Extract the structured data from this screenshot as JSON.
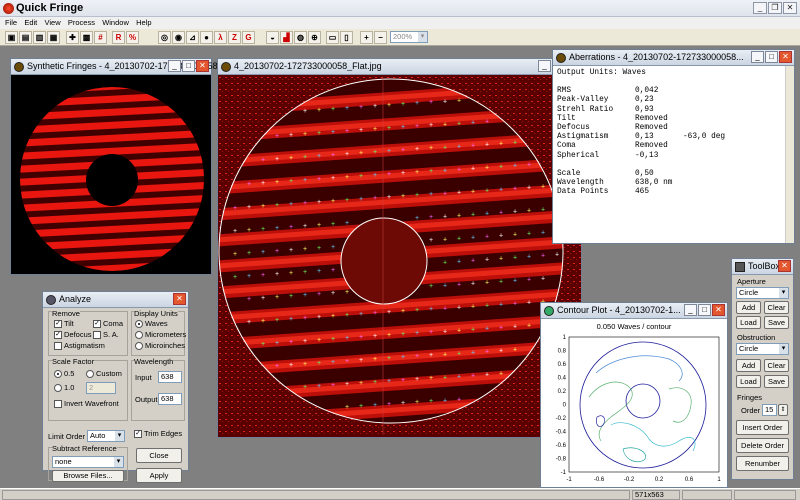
{
  "app": {
    "title": "Quick Fringe"
  },
  "menu": [
    "File",
    "Edit",
    "View",
    "Process",
    "Window",
    "Help"
  ],
  "toolbar": {
    "zoom": "200%",
    "icons": [
      "open-icon",
      "save-icon",
      "print-icon",
      "preview-icon",
      "tools-icon",
      "grid-icon",
      "table-icon",
      "r-icon",
      "percent-icon",
      "circle-icon",
      "fringe-icon",
      "plot-icon",
      "sphere-icon",
      "lambda-icon",
      "z-icon",
      "g-icon",
      "shell-icon",
      "chart-icon",
      "globe-icon",
      "export-icon",
      "zoom-in-icon",
      "zoom-out-icon"
    ]
  },
  "synthetic": {
    "title": "Synthetic Fringes - 4_20130702-172733000058..."
  },
  "flat": {
    "title": "4_20130702-172733000058_Flat.jpg"
  },
  "aberrations": {
    "title": "Aberrations - 4_20130702-172733000058...",
    "header": "Output Units: Waves",
    "rows": [
      {
        "k": "RMS",
        "v": "0,042",
        "x": ""
      },
      {
        "k": "Peak-Valley",
        "v": "0,23",
        "x": ""
      },
      {
        "k": "Strehl Ratio",
        "v": "0,93",
        "x": ""
      },
      {
        "k": "Tilt",
        "v": "Removed",
        "x": ""
      },
      {
        "k": "Defocus",
        "v": "Removed",
        "x": ""
      },
      {
        "k": "Astigmatism",
        "v": "0,13",
        "x": "-63,0 deg"
      },
      {
        "k": "Coma",
        "v": "Removed",
        "x": ""
      },
      {
        "k": "Spherical",
        "v": "-0,13",
        "x": ""
      }
    ],
    "rows2": [
      {
        "k": "Scale",
        "v": "0,50"
      },
      {
        "k": "Wavelength",
        "v": "638,0 nm"
      },
      {
        "k": "Data Points",
        "v": "465"
      }
    ]
  },
  "analyze": {
    "title": "Analyze",
    "remove": {
      "legend": "Remove",
      "tilt": "Tilt",
      "coma": "Coma",
      "defocus": "Defocus",
      "sa": "S. A.",
      "astig": "Astigmatism"
    },
    "display": {
      "legend": "Display Units",
      "waves": "Waves",
      "micrometers": "Micrometers",
      "microinches": "Microinches"
    },
    "scale": {
      "legend": "Scale Factor",
      "half": "0.5",
      "custom": "Custom",
      "one": "1.0",
      "custom_value": "2",
      "invert": "Invert Wavefront"
    },
    "wavelength": {
      "legend": "Wavelength",
      "input_label": "Input",
      "input": "638",
      "output_label": "Output",
      "output": "638"
    },
    "trim": "Trim Edges",
    "limit_label": "Limit Order",
    "limit": "Auto",
    "subtract": {
      "legend": "Subtract Reference",
      "value": "none",
      "browse": "Browse Files..."
    },
    "close": "Close",
    "apply": "Apply"
  },
  "contour": {
    "title": "Contour Plot - 4_20130702-1...",
    "subtitle": "0.050 Waves / contour",
    "y_ticks": [
      "1",
      "0.8",
      "0.6",
      "0.4",
      "0.2",
      "0",
      "-0.2",
      "-0.4",
      "-0.6",
      "-0.8",
      "-1"
    ],
    "x_ticks": [
      "-1",
      "-0.6",
      "-0.2",
      "0.2",
      "0.6",
      "1"
    ]
  },
  "toolbox": {
    "title": "ToolBox",
    "aperture": "Aperture",
    "aperture_shape": "Circle",
    "obstruction": "Obstruction",
    "obstruction_shape": "Circle",
    "add": "Add",
    "clear": "Clear",
    "load": "Load",
    "save": "Save",
    "fringes": "Fringes",
    "order_label": "Order",
    "order": "15",
    "insert": "Insert Order",
    "delete": "Delete Order",
    "renumber": "Renumber"
  },
  "status": {
    "size": "571x563"
  }
}
